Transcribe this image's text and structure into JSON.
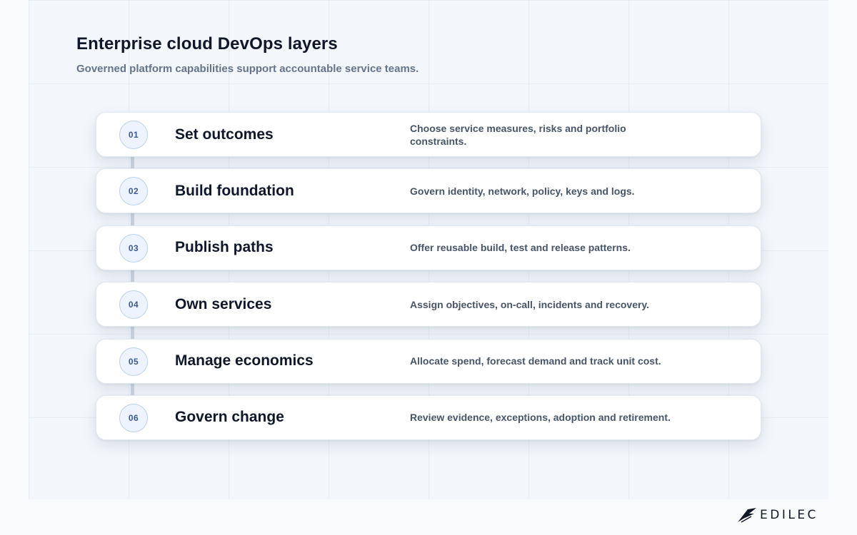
{
  "header": {
    "title": "Enterprise cloud DevOps layers",
    "subtitle": "Governed platform capabilities support accountable service teams."
  },
  "steps": [
    {
      "number": "01",
      "title": "Set outcomes",
      "description": "Choose service measures, risks and portfolio constraints."
    },
    {
      "number": "02",
      "title": "Build foundation",
      "description": "Govern identity, network, policy, keys and logs."
    },
    {
      "number": "03",
      "title": "Publish paths",
      "description": "Offer reusable build, test and release patterns."
    },
    {
      "number": "04",
      "title": "Own services",
      "description": "Assign objectives, on-call, incidents and recovery."
    },
    {
      "number": "05",
      "title": "Manage economics",
      "description": "Allocate spend, forecast demand and track unit cost."
    },
    {
      "number": "06",
      "title": "Govern change",
      "description": "Review evidence, exceptions, adoption and retirement."
    }
  ],
  "brand": {
    "name": "EDILEC",
    "icon": "edilec-logo-icon"
  }
}
